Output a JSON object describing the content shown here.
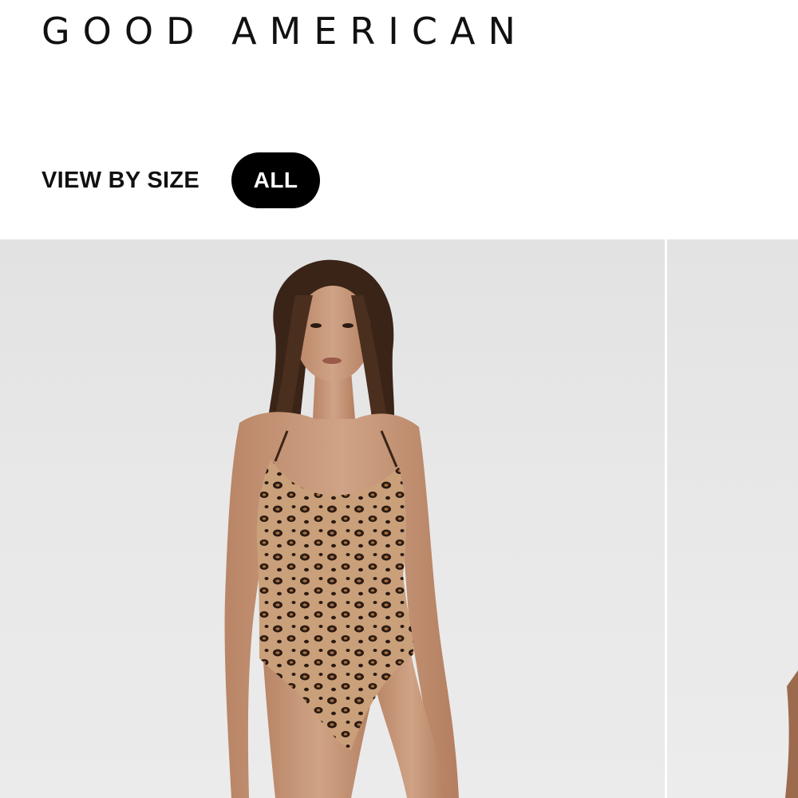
{
  "header": {
    "brand": "GOOD AMERICAN"
  },
  "filter": {
    "label": "VIEW BY SIZE",
    "selected_option": "ALL"
  },
  "products": [
    {
      "image": "model-leopard-print-one-piece-swimsuit"
    },
    {
      "image": "model-partial-next-product"
    }
  ],
  "colors": {
    "background": "#ffffff",
    "text": "#111111",
    "pill_background": "#000000",
    "pill_text": "#ffffff",
    "image_background": "#e6e6e6",
    "leopard_base": "#c9a07a",
    "leopard_spot": "#2a1a12"
  }
}
